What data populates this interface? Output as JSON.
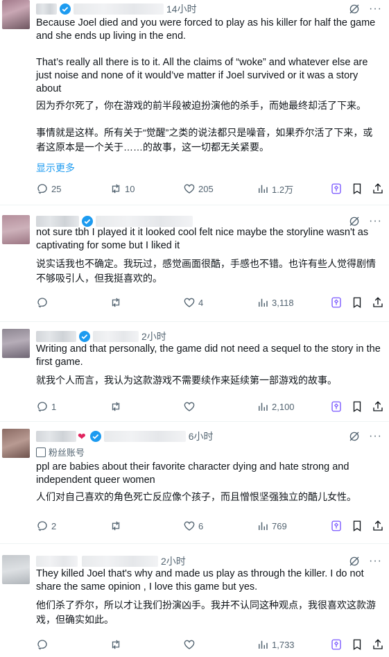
{
  "posts": [
    {
      "time": "14小时",
      "text_en_1": "Because Joel died and you were forced to play as his killer for half the game and she ends up living in the end.",
      "text_en_2": "That’s really all there is to it. All the claims of “woke” and whatever else are just noise and none of it would’ve matter if Joel survived or it was a story about",
      "text_zh_1": "因为乔尔死了，你在游戏的前半段被迫扮演他的杀手，而她最终却活了下来。",
      "text_zh_2": "事情就是这样。所有关于“觉醒”之类的说法都只是噪音，如果乔尔活了下来，或者这原本是一个关于……的故事，这一切都无关紧要。",
      "show_more": "显示更多",
      "replies": "25",
      "reposts": "10",
      "likes": "205",
      "views": "1.2万"
    },
    {
      "time": "",
      "text_en_1": "not sure tbh I played it it looked cool felt nice maybe the storyline wasn't as captivating for some but I liked it",
      "text_zh_1": "说实话我也不确定。我玩过，感觉画面很酷，手感也不错。也许有些人觉得剧情不够吸引人，但我挺喜欢的。",
      "replies": "",
      "reposts": "",
      "likes": "4",
      "views": "3,118"
    },
    {
      "time": "2小时",
      "text_en_1": "Writing and that personally, the game did not need a sequel to the story in the first game.",
      "text_zh_1": "就我个人而言，我认为这款游戏不需要续作来延续第一部游戏的故事。",
      "replies": "1",
      "reposts": "",
      "likes": "",
      "views": "2,100"
    },
    {
      "time": "6小时",
      "badge": "粉丝账号",
      "text_en_1": "ppl are babies about their favorite character dying and hate strong and independent queer women",
      "text_zh_1": "人们对自己喜欢的角色死亡反应像个孩子，而且憎恨坚强独立的酷儿女性。",
      "replies": "2",
      "reposts": "",
      "likes": "6",
      "views": "769"
    },
    {
      "time": "2小时",
      "text_en_1": "They killed Joel that's why and made us play as through the killer. I do not share the same opinion , I love this game but yes.",
      "text_zh_1": "他们杀了乔尔，所以才让我们扮演凶手。我并不认同这种观点，我很喜欢这款游戏，但确实如此。",
      "replies": "",
      "reposts": "",
      "likes": "",
      "views": "1,733"
    }
  ],
  "colors": {
    "accent": "#1d9bf0",
    "muted": "#536471",
    "text": "#0f1419",
    "divider": "#eff3f4"
  },
  "icons": [
    "verified-icon",
    "grok-icon",
    "more-icon",
    "reply-icon",
    "repost-icon",
    "like-icon",
    "views-icon",
    "grok-analyze-icon",
    "bookmark-icon",
    "share-icon",
    "fan-account-icon"
  ]
}
